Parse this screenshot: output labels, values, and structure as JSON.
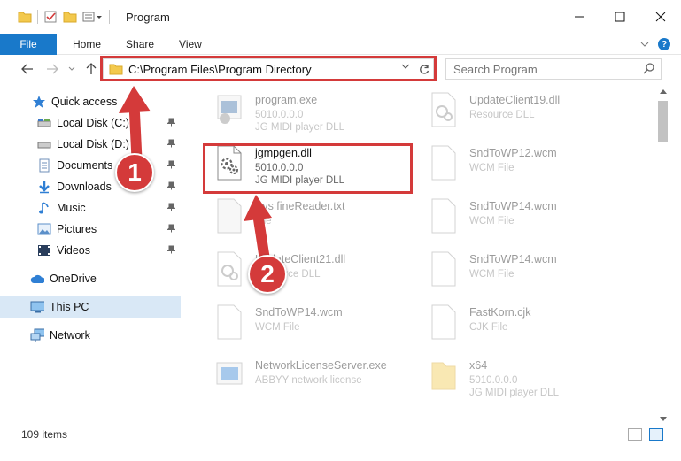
{
  "window": {
    "title": "Program",
    "minimize_icon": "minimize-icon",
    "maximize_icon": "maximize-icon",
    "close_icon": "close-icon"
  },
  "ribbon": {
    "tabs": [
      "File",
      "Home",
      "Share",
      "View"
    ]
  },
  "address": {
    "path": "C:\\Program Files\\Program Directory"
  },
  "search": {
    "placeholder": "Search Program"
  },
  "sidebar": {
    "items": [
      {
        "label": "Quick access",
        "icon": "star-icon",
        "pinned": false
      },
      {
        "label": "Local Disk (C:)",
        "icon": "drive-icon",
        "pinned": true
      },
      {
        "label": "Local Disk (D:)",
        "icon": "drive-icon",
        "pinned": true
      },
      {
        "label": "Documents",
        "icon": "documents-icon",
        "pinned": true
      },
      {
        "label": "Downloads",
        "icon": "download-icon",
        "pinned": true
      },
      {
        "label": "Music",
        "icon": "music-icon",
        "pinned": true
      },
      {
        "label": "Pictures",
        "icon": "pictures-icon",
        "pinned": true
      },
      {
        "label": "Videos",
        "icon": "videos-icon",
        "pinned": true
      },
      {
        "label": "OneDrive",
        "icon": "cloud-icon",
        "pinned": false
      },
      {
        "label": "This PC",
        "icon": "computer-icon",
        "pinned": false
      },
      {
        "label": "Network",
        "icon": "network-icon",
        "pinned": false
      }
    ]
  },
  "files": [
    {
      "name": "program.exe",
      "line2": "5010.0.0.0",
      "line3": "JG MIDI player DLL"
    },
    {
      "name": "UpdateClient19.dll",
      "line2": "Resource DLL",
      "line3": ""
    },
    {
      "name": "jgmpgen.dll",
      "line2": "5010.0.0.0",
      "line3": "JG MIDI player DLL"
    },
    {
      "name": "SndToWP12.wcm",
      "line2": "WCM File",
      "line3": ""
    },
    {
      "name": "Sys fineReader.txt",
      "line2": "File",
      "line3": ""
    },
    {
      "name": "SndToWP14.wcm",
      "line2": "WCM File",
      "line3": ""
    },
    {
      "name": "UpdateClient21.dll",
      "line2": "Resource DLL",
      "line3": ""
    },
    {
      "name": "SndToWP14.wcm",
      "line2": "WCM File",
      "line3": ""
    },
    {
      "name": "SndToWP14.wcm",
      "line2": "WCM File",
      "line3": ""
    },
    {
      "name": "FastKorn.cjk",
      "line2": "CJK File",
      "line3": ""
    },
    {
      "name": "NetworkLicenseServer.exe",
      "line2": "ABBYY network license",
      "line3": ""
    },
    {
      "name": "x64",
      "line2": "5010.0.0.0",
      "line3": "JG MIDI player DLL"
    }
  ],
  "status": {
    "count": "109 items"
  },
  "annotations": {
    "badge1": "1",
    "badge2": "2",
    "color": "#d43a3a"
  }
}
